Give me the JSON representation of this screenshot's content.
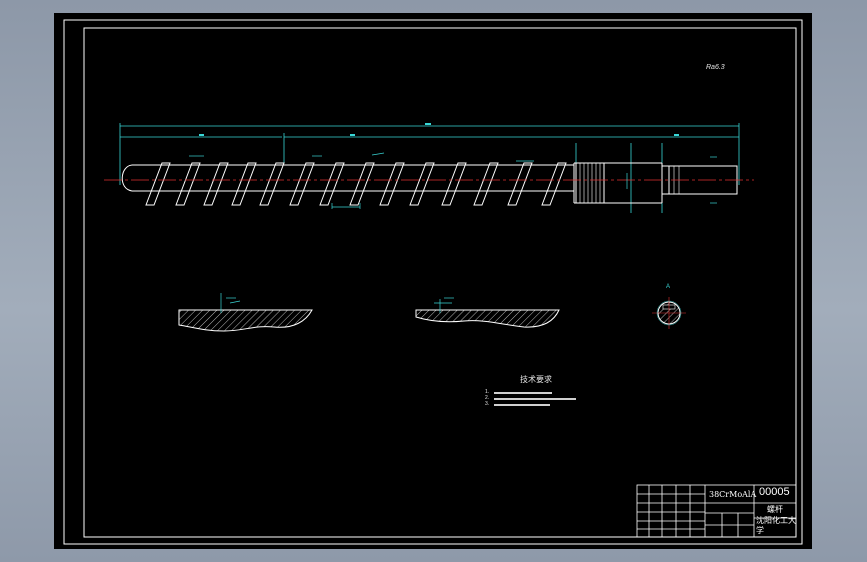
{
  "drawing": {
    "corner_note": "Ra6.3",
    "section_label": "A",
    "tech_requirements": {
      "title": "技术要求",
      "items": [
        "1.",
        "2.",
        "3."
      ]
    },
    "title_block": {
      "material": "38CrMoAlA",
      "drawing_number": "00005",
      "part_name": "螺杆",
      "school": "沈阳化工大学"
    }
  }
}
